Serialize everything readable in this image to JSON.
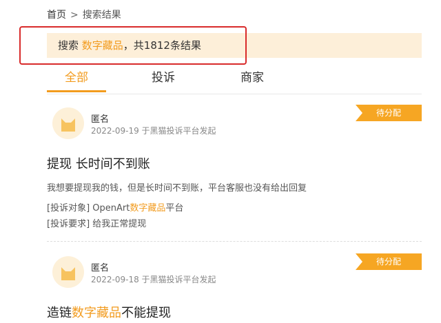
{
  "breadcrumb": {
    "home": "首页",
    "separator": ">",
    "current": "搜索结果"
  },
  "search": {
    "prefix": "搜索 ",
    "keyword": "数字藏品",
    "suffix": "，共1812条结果"
  },
  "tabs": [
    {
      "label": "全部",
      "active": true
    },
    {
      "label": "投诉",
      "active": false
    },
    {
      "label": "商家",
      "active": false
    }
  ],
  "results": [
    {
      "user": "匿名",
      "meta": "2022-09-19 于黑猫投诉平台发起",
      "badge": "待分配",
      "title": "提现 长时间不到账",
      "desc": "我想要提现我的钱，但是长时间不到账，平台客服也没有给出回复",
      "target_label": "[投诉对象]",
      "target_pre": "OpenArt",
      "target_kw": "数字藏品",
      "target_post": "平台",
      "request_label": "[投诉要求]",
      "request": "给我正常提现"
    },
    {
      "user": "匿名",
      "meta": "2022-09-18 于黑猫投诉平台发起",
      "badge": "待分配",
      "title_pre": "造链",
      "title_kw": "数字藏品",
      "title_post": "不能提现"
    }
  ],
  "colors": {
    "accent": "#f29b1e",
    "highlight_border": "#d82a2a",
    "result_bg": "#fdefd9",
    "badge": "#f6a623"
  }
}
